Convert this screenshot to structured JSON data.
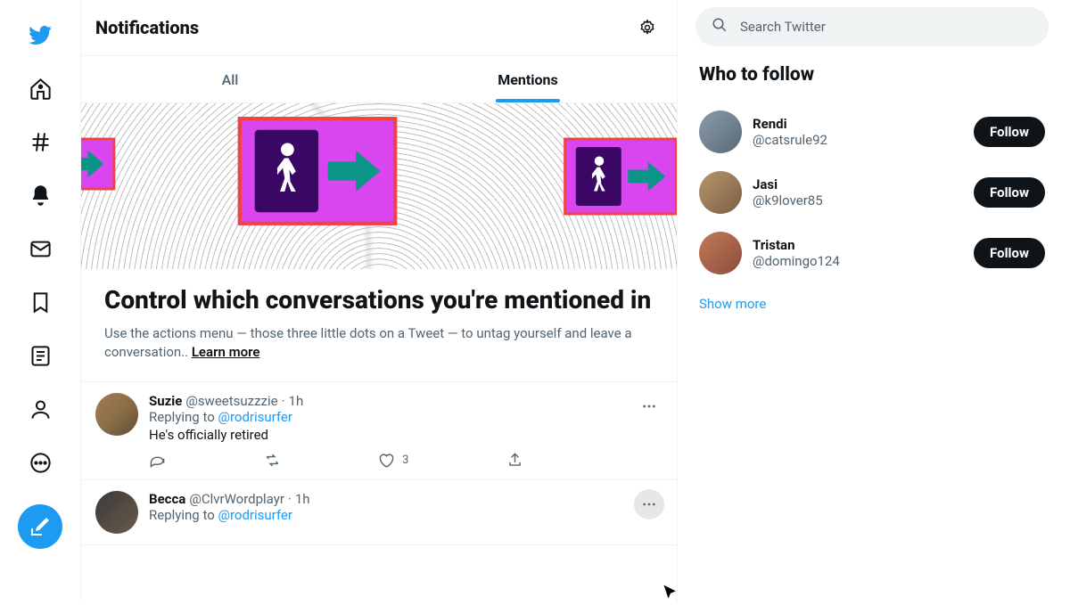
{
  "header": {
    "title": "Notifications"
  },
  "tabs": {
    "all": "All",
    "mentions": "Mentions"
  },
  "promo": {
    "heading": "Control which conversations you're mentioned in",
    "body": "Use the actions menu — those three little dots on a Tweet — to untag yourself and leave a conversation.. ",
    "learn": "Learn more"
  },
  "tweets": [
    {
      "name": "Suzie",
      "handle": "@sweetsuzzzie",
      "time": "1h",
      "replying_prefix": "Replying to ",
      "replying_to": "@rodrisurfer",
      "text": "He's officially retired",
      "like_count": "3"
    },
    {
      "name": "Becca",
      "handle": "@ClvrWordplayr",
      "time": "1h",
      "replying_prefix": "Replying to ",
      "replying_to": "@rodrisurfer"
    }
  ],
  "search": {
    "placeholder": "Search Twitter"
  },
  "wtf": {
    "title": "Who to follow",
    "items": [
      {
        "name": "Rendi",
        "handle": "@catsrule92",
        "button": "Follow"
      },
      {
        "name": "Jasi",
        "handle": "@k9lover85",
        "button": "Follow"
      },
      {
        "name": "Tristan",
        "handle": "@domingo124",
        "button": "Follow"
      }
    ],
    "showmore": "Show more"
  }
}
